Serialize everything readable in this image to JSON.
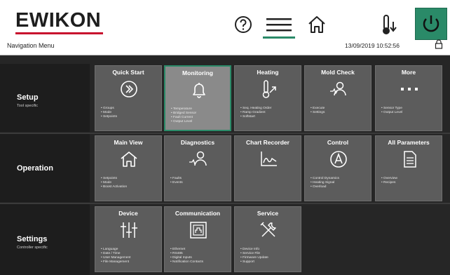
{
  "header": {
    "logo": "EWIKON",
    "nav_title": "Navigation Menu",
    "datetime": "13/09/2019 10:52:56",
    "colors": {
      "accent": "#2a8a68",
      "brand_red": "#c8102e"
    },
    "icons": [
      "help-icon",
      "menu-icon",
      "home-icon",
      "temperature-icon",
      "power-icon",
      "lock-icon"
    ]
  },
  "rows": [
    {
      "label": "Setup",
      "sub": "Tool specific"
    },
    {
      "label": "Operation",
      "sub": ""
    },
    {
      "label": "Settings",
      "sub": "Controller specific"
    }
  ],
  "tiles": {
    "quick_start": {
      "title": "Quick Start",
      "icon": "chevrons-right-icon",
      "items": [
        "Groups",
        "Mode",
        "Setpoints"
      ]
    },
    "monitoring": {
      "title": "Monitoring",
      "icon": "bell-icon",
      "items": [
        "Temperature",
        "Bridged Sensor",
        "Fault Current",
        "Output Level"
      ]
    },
    "heating": {
      "title": "Heating",
      "icon": "thermometer-up-icon",
      "items": [
        "Seq. Heating Order",
        "Ramp Gradient",
        "Softstart"
      ]
    },
    "mold_check": {
      "title": "Mold Check",
      "icon": "person-check-icon",
      "items": [
        "Execute",
        "Settings"
      ]
    },
    "more": {
      "title": "More",
      "icon": "more-dots-icon",
      "items": [
        "Sensor Type",
        "Output Level"
      ]
    },
    "main_view": {
      "title": "Main View",
      "icon": "home-icon",
      "items": [
        "Setpoints",
        "Mode",
        "Boost Activation"
      ]
    },
    "diagnostics": {
      "title": "Diagnostics",
      "icon": "diagnostics-icon",
      "items": [
        "Faults",
        "Events"
      ]
    },
    "chart_recorder": {
      "title": "Chart Recorder",
      "icon": "chart-icon",
      "items": []
    },
    "control": {
      "title": "Control",
      "icon": "a-circle-icon",
      "items": [
        "Control Dynamics",
        "Heating Signal",
        "Overload"
      ]
    },
    "all_parameters": {
      "title": "All Parameters",
      "icon": "document-icon",
      "items": [
        "Overview",
        "Recipes"
      ]
    },
    "device": {
      "title": "Device",
      "icon": "sliders-icon",
      "items": [
        "Language",
        "Date / Time",
        "User Management",
        "File Management"
      ]
    },
    "communication": {
      "title": "Communication",
      "icon": "network-icon",
      "items": [
        "Ethernet",
        "RS485",
        "Digital Inputs",
        "Notification Contacts"
      ]
    },
    "service": {
      "title": "Service",
      "icon": "tools-icon",
      "items": [
        "Device Info",
        "Service File",
        "Firmware Update",
        "Support"
      ]
    }
  }
}
